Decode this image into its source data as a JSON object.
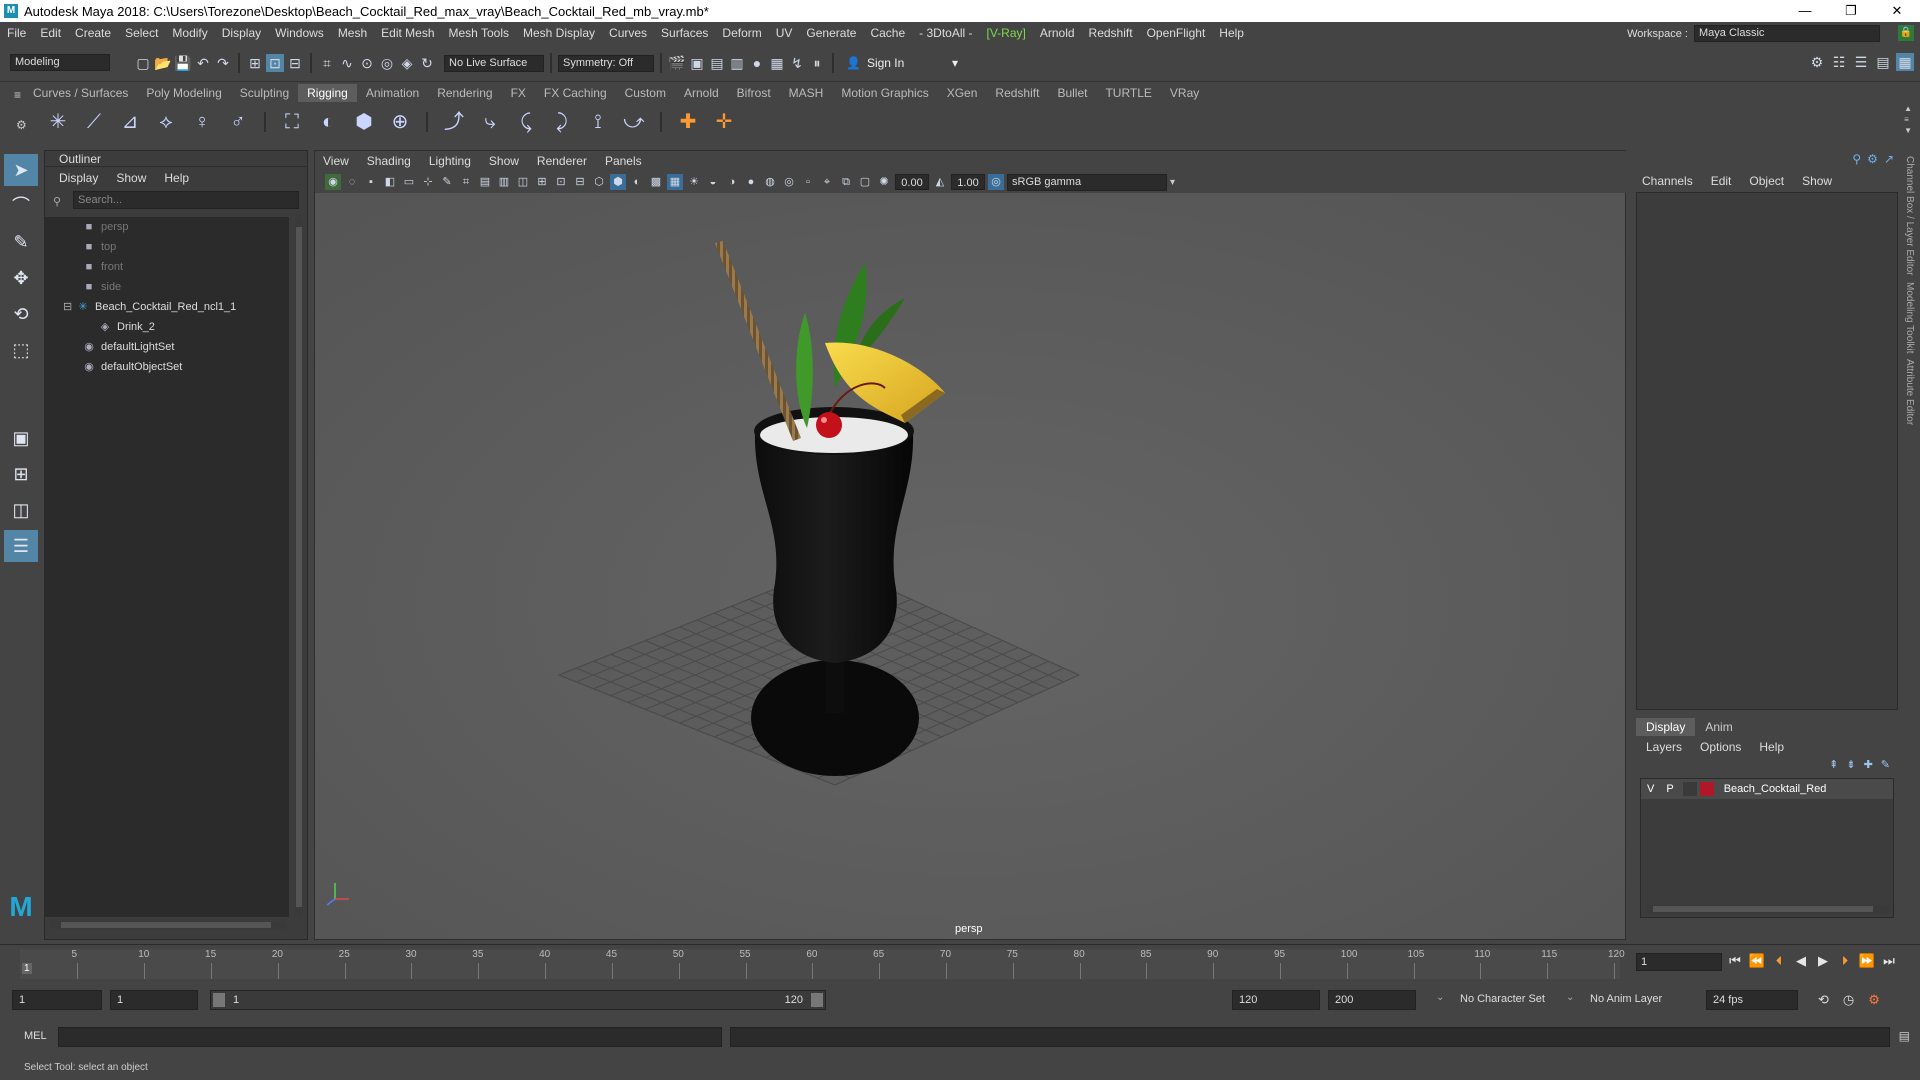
{
  "window": {
    "title": "Autodesk Maya 2018: C:\\Users\\Torezone\\Desktop\\Beach_Cocktail_Red_max_vray\\Beach_Cocktail_Red_mb_vray.mb*",
    "minimize": "—",
    "restore": "❐",
    "close": "✕"
  },
  "menubar": {
    "items": [
      "File",
      "Edit",
      "Create",
      "Select",
      "Modify",
      "Display",
      "Windows",
      "Mesh",
      "Edit Mesh",
      "Mesh Tools",
      "Mesh Display",
      "Curves",
      "Surfaces",
      "Deform",
      "UV",
      "Generate",
      "Cache",
      "- 3DtoAll -",
      "[V-Ray]",
      "Arnold",
      "Redshift",
      "OpenFlight",
      "Help"
    ],
    "workspace_label": "Workspace :",
    "workspace_value": "Maya Classic"
  },
  "statusline": {
    "mode": "Modeling",
    "live_surface": "No Live Surface",
    "symmetry": "Symmetry: Off",
    "sign_in": "Sign In"
  },
  "shelf": {
    "tabs": [
      "Curves / Surfaces",
      "Poly Modeling",
      "Sculpting",
      "Rigging",
      "Animation",
      "Rendering",
      "FX",
      "FX Caching",
      "Custom",
      "Arnold",
      "Bifrost",
      "MASH",
      "Motion Graphics",
      "XGen",
      "Redshift",
      "Bullet",
      "TURTLE",
      "VRay"
    ],
    "active_tab": "Rigging"
  },
  "outliner": {
    "title": "Outliner",
    "menu": [
      "Display",
      "Show",
      "Help"
    ],
    "search_placeholder": "Search...",
    "items": [
      {
        "label": "persp",
        "type": "camera",
        "dim": true
      },
      {
        "label": "top",
        "type": "camera",
        "dim": true
      },
      {
        "label": "front",
        "type": "camera",
        "dim": true
      },
      {
        "label": "side",
        "type": "camera",
        "dim": true
      },
      {
        "label": "Beach_Cocktail_Red_ncl1_1",
        "type": "group",
        "dim": false
      },
      {
        "label": "Drink_2",
        "type": "mesh",
        "dim": false
      },
      {
        "label": "defaultLightSet",
        "type": "set",
        "dim": false
      },
      {
        "label": "defaultObjectSet",
        "type": "set",
        "dim": false
      }
    ]
  },
  "viewport": {
    "menu": [
      "View",
      "Shading",
      "Lighting",
      "Show",
      "Renderer",
      "Panels"
    ],
    "exposure": "0.00",
    "gamma": "1.00",
    "color_space": "sRGB gamma",
    "camera_label": "persp"
  },
  "channelbox": {
    "menu": [
      "Channels",
      "Edit",
      "Object",
      "Show"
    ],
    "side_tabs": [
      "Channel Box / Layer Editor",
      "Modeling Toolkit",
      "Attribute Editor"
    ]
  },
  "layer_editor": {
    "tabs": [
      "Display",
      "Anim"
    ],
    "menu": [
      "Layers",
      "Options",
      "Help"
    ],
    "layer": {
      "v": "V",
      "p": "P",
      "name": "Beach_Cocktail_Red",
      "color": "#b0182a"
    }
  },
  "timeline": {
    "ticks": [
      "5",
      "10",
      "15",
      "20",
      "25",
      "30",
      "35",
      "40",
      "45",
      "50",
      "55",
      "60",
      "65",
      "70",
      "75",
      "80",
      "85",
      "90",
      "95",
      "100",
      "105",
      "110",
      "115",
      "120"
    ],
    "start_marker": "1",
    "current_frame": "1"
  },
  "range": {
    "start": "1",
    "playback_start": "1",
    "slider_start": "1",
    "slider_end": "120",
    "playback_end": "120",
    "end": "200",
    "character_set": "No Character Set",
    "anim_layer": "No Anim Layer",
    "fps": "24 fps"
  },
  "command": {
    "label": "MEL"
  },
  "help": {
    "text": "Select Tool: select an object"
  }
}
